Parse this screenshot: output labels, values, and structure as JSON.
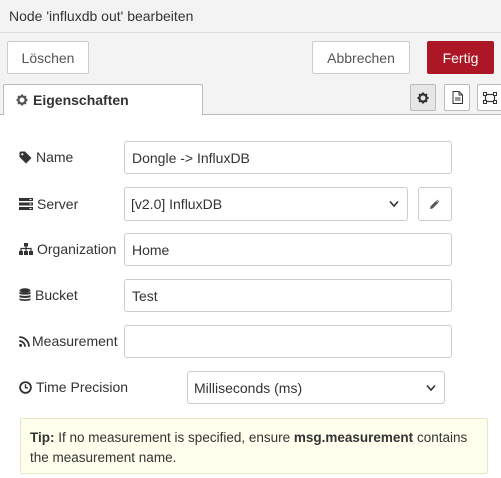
{
  "dialog": {
    "title": "Node 'influxdb out' bearbeiten"
  },
  "buttons": {
    "delete": "Löschen",
    "cancel": "Abbrechen",
    "done": "Fertig"
  },
  "tabs": {
    "properties": "Eigenschaften",
    "icons": [
      "gear-icon",
      "document-icon",
      "frame-icon"
    ]
  },
  "form": {
    "name": {
      "label": "Name",
      "value": "Dongle -> InfluxDB",
      "icon": "tag-icon"
    },
    "server": {
      "label": "Server",
      "value": "[v2.0] InfluxDB",
      "icon": "server-icon"
    },
    "organization": {
      "label": "Organization",
      "value": "Home",
      "icon": "sitemap-icon"
    },
    "bucket": {
      "label": "Bucket",
      "value": "Test",
      "icon": "database-icon"
    },
    "measurement": {
      "label": "Measurement",
      "value": "",
      "icon": "rss-icon"
    },
    "time_precision": {
      "label": "Time Precision",
      "value": "Milliseconds (ms)",
      "icon": "clock-icon"
    }
  },
  "tip": {
    "prefix": "Tip:",
    "text1": " If no measurement is specified, ensure ",
    "code": "msg.measurement",
    "text2": " contains the measurement name."
  },
  "colors": {
    "accent": "#ad1625",
    "tip_bg": "#ffffee"
  }
}
